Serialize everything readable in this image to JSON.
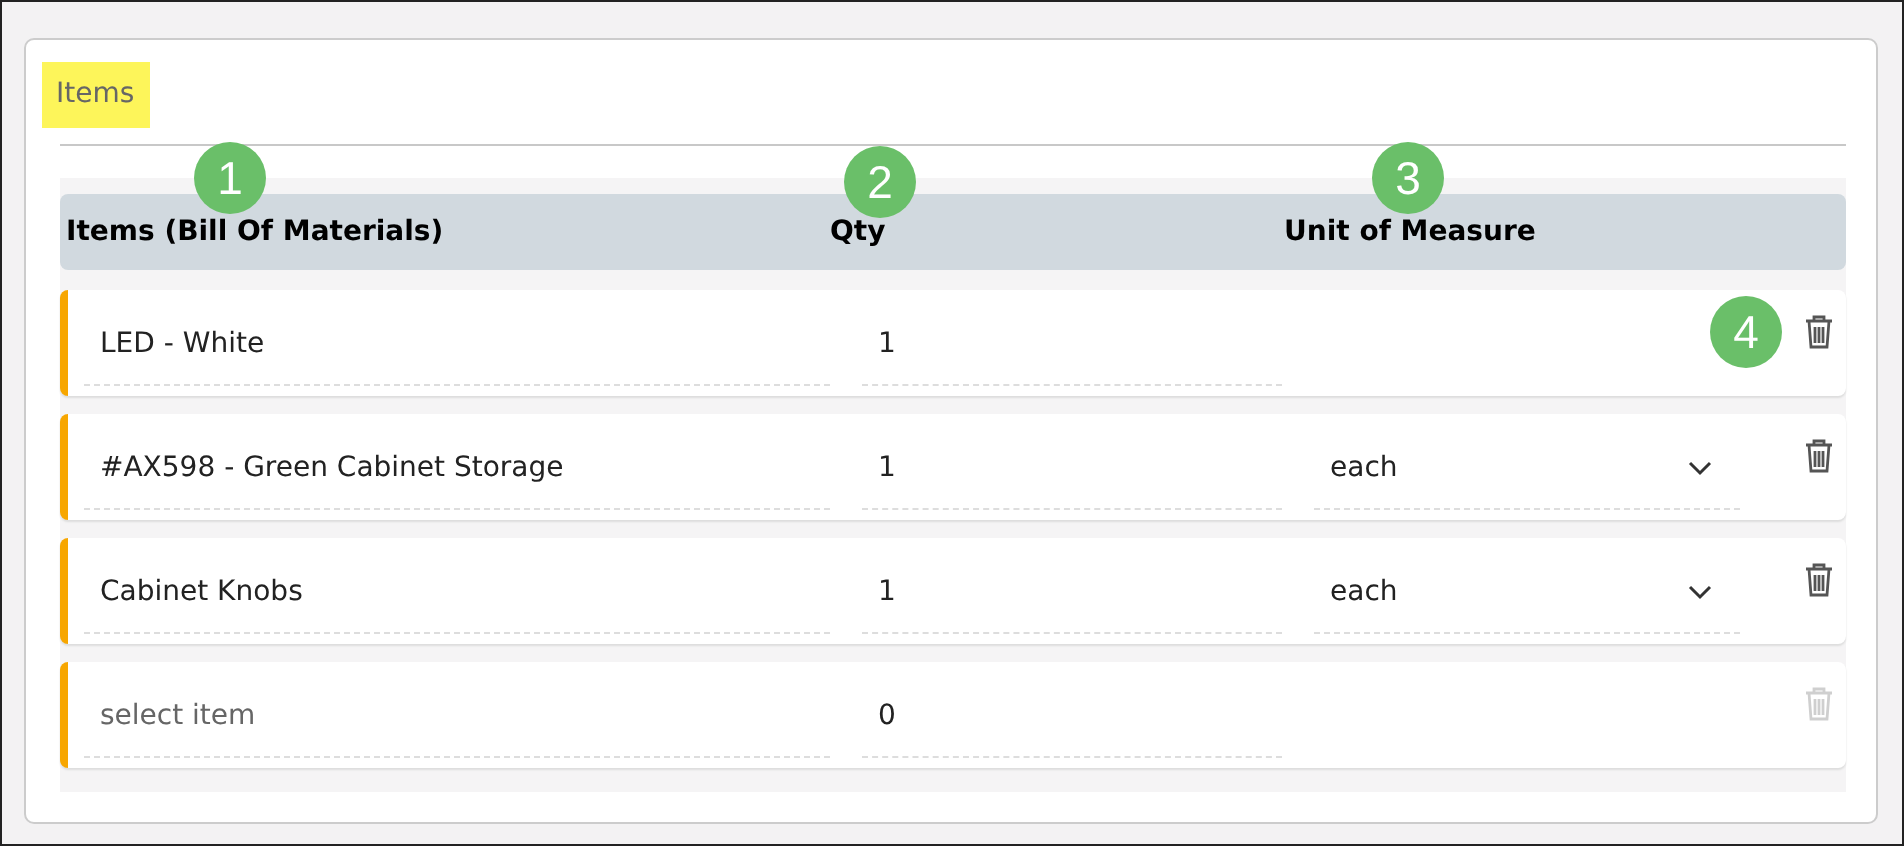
{
  "section": {
    "title": "Items"
  },
  "columns": [
    "Items (Bill Of Materials)",
    "Qty",
    "Unit of Measure"
  ],
  "rows": [
    {
      "item": "LED - White",
      "qty": "1",
      "delete_disabled": false
    },
    {
      "item": "#AX598 - Green Cabinet Storage",
      "qty": "1",
      "unit": "each",
      "delete_disabled": false
    },
    {
      "item": "Cabinet Knobs",
      "qty": "1",
      "unit": "each",
      "delete_disabled": false
    },
    {
      "placeholder": "select item",
      "qty": "0",
      "delete_disabled": true
    }
  ],
  "callouts": [
    {
      "label": "1"
    },
    {
      "label": "2"
    },
    {
      "label": "3"
    },
    {
      "label": "4"
    }
  ]
}
